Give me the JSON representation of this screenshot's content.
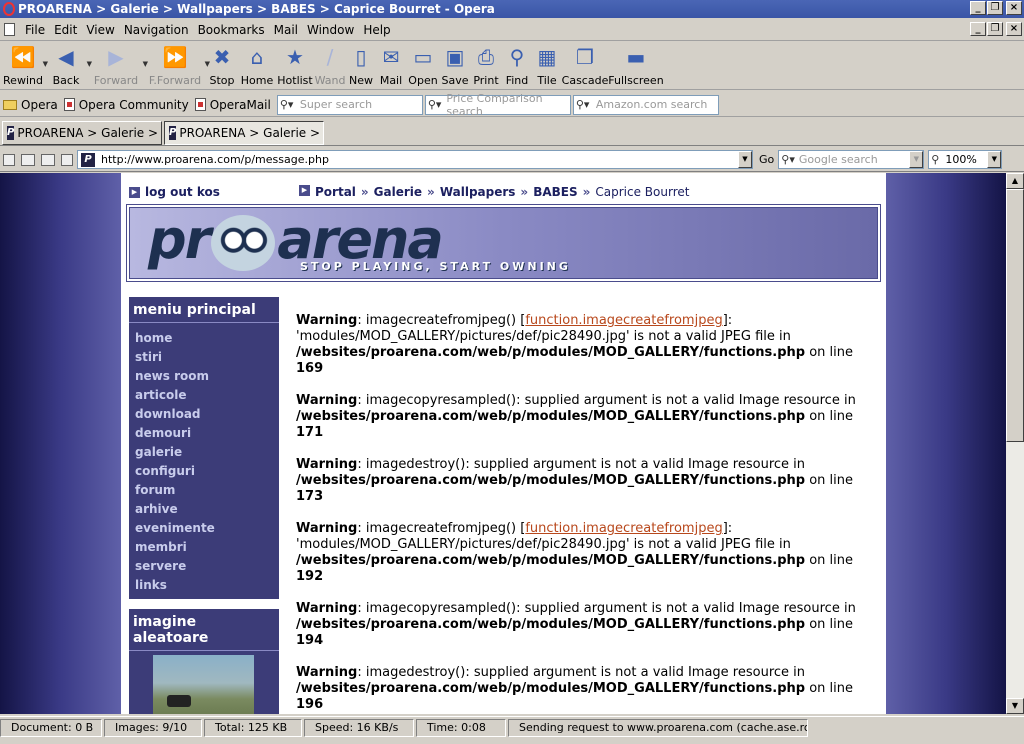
{
  "window": {
    "title": "PROARENA > Galerie > Wallpapers > BABES > Caprice Bourret - Opera"
  },
  "menu": [
    "File",
    "Edit",
    "View",
    "Navigation",
    "Bookmarks",
    "Mail",
    "Window",
    "Help"
  ],
  "toolbar": [
    {
      "label": "Rewind",
      "icon": "rewind-icon",
      "glyph": "⏪",
      "disabled": false,
      "drop": true
    },
    {
      "label": "Back",
      "icon": "back-icon",
      "glyph": "◀",
      "disabled": false,
      "drop": true
    },
    {
      "label": "Forward",
      "icon": "forward-icon",
      "glyph": "▶",
      "disabled": true,
      "drop": true
    },
    {
      "label": "F.Forward",
      "icon": "fast-forward-icon",
      "glyph": "⏩",
      "disabled": true,
      "drop": true
    },
    {
      "label": "Stop",
      "icon": "stop-icon",
      "glyph": "✖",
      "disabled": false,
      "drop": false
    },
    {
      "label": "Home",
      "icon": "home-icon",
      "glyph": "⌂",
      "disabled": false,
      "drop": false
    },
    {
      "label": "Hotlist",
      "icon": "hotlist-icon",
      "glyph": "★",
      "disabled": false,
      "drop": false
    },
    {
      "label": "Wand",
      "icon": "wand-icon",
      "glyph": "/",
      "disabled": true,
      "drop": false
    },
    {
      "label": "New",
      "icon": "new-page-icon",
      "glyph": "▯",
      "disabled": false,
      "drop": false
    },
    {
      "label": "Mail",
      "icon": "mail-icon",
      "glyph": "✉",
      "disabled": false,
      "drop": false
    },
    {
      "label": "Open",
      "icon": "open-folder-icon",
      "glyph": "▭",
      "disabled": false,
      "drop": false
    },
    {
      "label": "Save",
      "icon": "save-icon",
      "glyph": "▣",
      "disabled": false,
      "drop": false
    },
    {
      "label": "Print",
      "icon": "print-icon",
      "glyph": "⎙",
      "disabled": false,
      "drop": false
    },
    {
      "label": "Find",
      "icon": "find-icon",
      "glyph": "⚲",
      "disabled": false,
      "drop": false
    },
    {
      "label": "Tile",
      "icon": "tile-icon",
      "glyph": "▦",
      "disabled": false,
      "drop": false
    },
    {
      "label": "Cascade",
      "icon": "cascade-icon",
      "glyph": "❐",
      "disabled": false,
      "drop": false
    },
    {
      "label": "Fullscreen",
      "icon": "fullscreen-icon",
      "glyph": "▬",
      "disabled": false,
      "drop": false
    }
  ],
  "personal_bar": {
    "items": [
      "Opera",
      "Opera Community",
      "OperaMail"
    ],
    "searches": [
      "Super search",
      "Price Comparison search",
      "Amazon.com search"
    ]
  },
  "tabs": [
    "PROARENA > Galerie > ...",
    "PROARENA > Galerie > ..."
  ],
  "address": {
    "url": "http://www.proarena.com/p/message.php",
    "go": "Go",
    "search_placeholder": "Google search",
    "zoom": "100%"
  },
  "page": {
    "logout": "log out kos",
    "breadcrumb": [
      "Portal",
      "Galerie",
      "Wallpapers",
      "BABES",
      "Caprice Bourret"
    ],
    "logo_left": "pr",
    "logo_right": "arena",
    "tagline": "STOP PLAYING, START OWNING",
    "menu_title": "meniu principal",
    "menu_items": [
      "home",
      "stiri",
      "news room",
      "articole",
      "download",
      "demouri",
      "galerie",
      "configuri",
      "forum",
      "arhive",
      "evenimente",
      "membri",
      "servere",
      "links"
    ],
    "random_title": "imagine aleatoare",
    "warnings": [
      {
        "label": "Warning",
        "pre": ": imagecreatefromjpeg() [",
        "link": "function.imagecreatefromjpeg",
        "mid": "]: 'modules/MOD_GALLERY/pictures/def/pic28490.jpg' is not a valid JPEG file in ",
        "path": "/websites/proarena.com/web/p/modules/MOD_GALLERY/functions.php",
        "online": " on line ",
        "line": "169"
      },
      {
        "label": "Warning",
        "pre": ": imagecopyresampled(): supplied argument is not a valid Image resource in ",
        "link": "",
        "mid": "",
        "path": "/websites/proarena.com/web/p/modules/MOD_GALLERY/functions.php",
        "online": " on line ",
        "line": "171"
      },
      {
        "label": "Warning",
        "pre": ": imagedestroy(): supplied argument is not a valid Image resource in ",
        "link": "",
        "mid": "",
        "path": "/websites/proarena.com/web/p/modules/MOD_GALLERY/functions.php",
        "online": " on line ",
        "line": "173"
      },
      {
        "label": "Warning",
        "pre": ": imagecreatefromjpeg() [",
        "link": "function.imagecreatefromjpeg",
        "mid": "]: 'modules/MOD_GALLERY/pictures/def/pic28490.jpg' is not a valid JPEG file in ",
        "path": "/websites/proarena.com/web/p/modules/MOD_GALLERY/functions.php",
        "online": " on line ",
        "line": "192"
      },
      {
        "label": "Warning",
        "pre": ": imagecopyresampled(): supplied argument is not a valid Image resource in ",
        "link": "",
        "mid": "",
        "path": "/websites/proarena.com/web/p/modules/MOD_GALLERY/functions.php",
        "online": " on line ",
        "line": "194"
      },
      {
        "label": "Warning",
        "pre": ": imagedestroy(): supplied argument is not a valid Image resource in ",
        "link": "",
        "mid": "",
        "path": "/websites/proarena.com/web/p/modules/MOD_GALLERY/functions.php",
        "online": " on line ",
        "line": "196"
      }
    ]
  },
  "status": {
    "document": "Document:   0 B",
    "images": "Images:   9/10",
    "total": "Total:   125 KB",
    "speed": "Speed:   16 KB/s",
    "time": "Time:   0:08",
    "message": "Sending request to www.proarena.com (cache.ase.ro)..."
  },
  "colors": {
    "titlebar": "#3a55a6",
    "page_bg": "#8080b8",
    "sidebar": "#3c3c78",
    "link": "#b8481c"
  }
}
